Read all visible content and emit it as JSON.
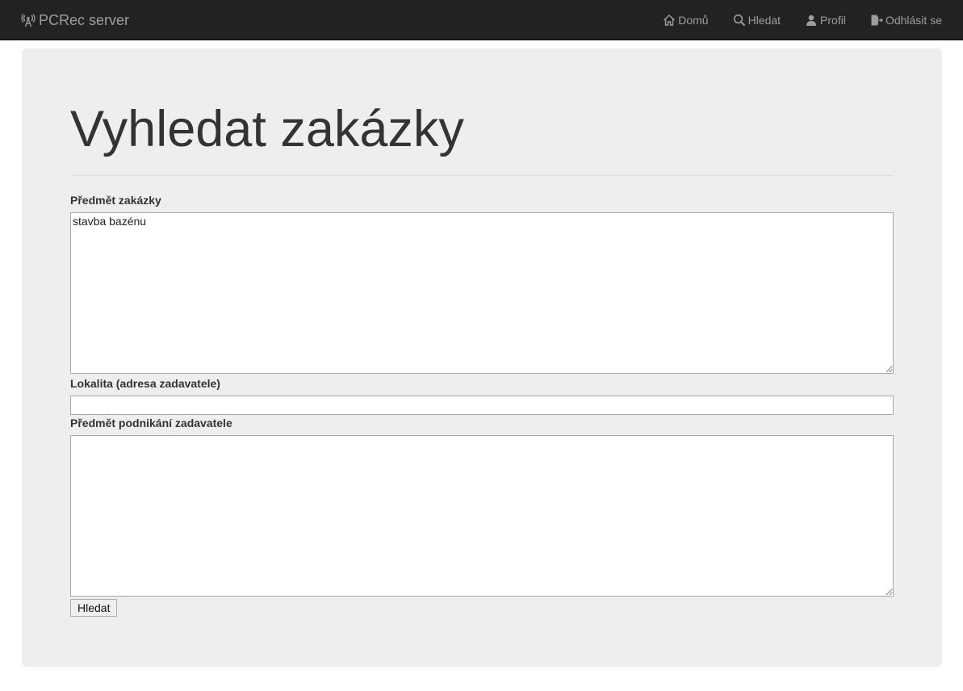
{
  "navbar": {
    "brand": "PCRec server",
    "brand_icon": "radio-tower-icon",
    "links": [
      {
        "label": "Domů",
        "icon": "home-icon"
      },
      {
        "label": "Hledat",
        "icon": "search-icon"
      },
      {
        "label": "Profil",
        "icon": "user-icon"
      },
      {
        "label": "Odhlásit se",
        "icon": "log-out-icon"
      }
    ]
  },
  "main": {
    "title": "Vyhledat zakázky",
    "fields": {
      "subject": {
        "label": "Předmět zakázky",
        "value": "stavba bazénu"
      },
      "locality": {
        "label": "Lokalita (adresa zadavatele)",
        "value": ""
      },
      "business": {
        "label": "Předmět podnikání zadavatele",
        "value": ""
      }
    },
    "submit_label": "Hledat"
  },
  "colors": {
    "navbar_bg": "#222222",
    "nav_text": "#9d9d9d",
    "jumbotron_bg": "#eeeeee",
    "text": "#333333"
  }
}
